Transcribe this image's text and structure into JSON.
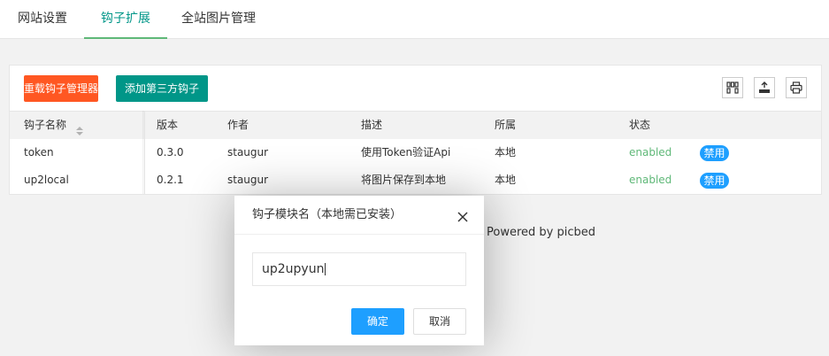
{
  "tabs": [
    {
      "label": "网站设置"
    },
    {
      "label": "钩子扩展"
    },
    {
      "label": "全站图片管理"
    }
  ],
  "toolbar": {
    "reload_label": "重载钩子管理器",
    "add_label": "添加第三方钩子",
    "tools": [
      "columns-icon",
      "export-icon",
      "print-icon"
    ]
  },
  "table": {
    "headers": [
      "钩子名称",
      "版本",
      "作者",
      "描述",
      "所属",
      "状态"
    ],
    "rows": [
      {
        "name": "token",
        "version": "0.3.0",
        "author": "staugur",
        "description": "使用Token验证Api",
        "scope": "本地",
        "status": "enabled",
        "action": "禁用"
      },
      {
        "name": "up2local",
        "version": "0.2.1",
        "author": "staugur",
        "description": "将图片保存到本地",
        "scope": "本地",
        "status": "enabled",
        "action": "禁用"
      }
    ]
  },
  "footer": {
    "text": "Powered by picbed"
  },
  "dialog": {
    "title": "钩子模块名（本地需已安装）",
    "input_value": "up2upyun",
    "ok_label": "确定",
    "cancel_label": "取消"
  },
  "colors": {
    "accent": "#009688",
    "danger": "#ff5722",
    "primary": "#1e9fff",
    "enabled": "#5fb878"
  }
}
